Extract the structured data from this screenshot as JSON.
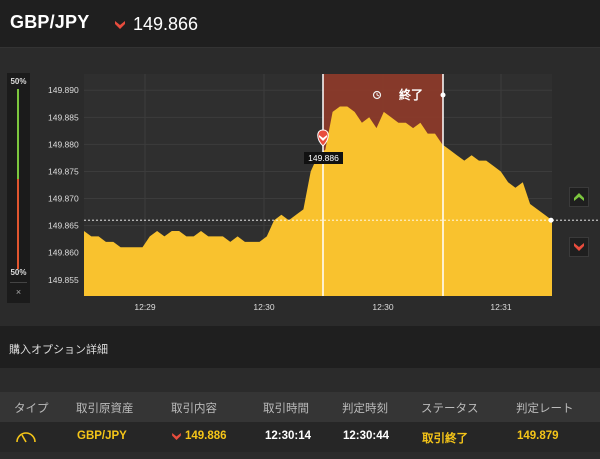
{
  "header": {
    "pair": "GBP/JPY",
    "rate": "149.866",
    "direction_icon": "down-arrow-icon",
    "down_color": "#e84c3d"
  },
  "gauge": {
    "top_label": "50%",
    "bottom_label": "50%",
    "close_label": "×",
    "call_fraction": 0.5,
    "put_fraction": 0.5,
    "call_color": "#7cc63e",
    "put_color": "#e0552f"
  },
  "chart_data": {
    "type": "area",
    "y_ticks": [
      "149.890",
      "149.885",
      "149.880",
      "149.875",
      "149.870",
      "149.865",
      "149.860",
      "149.855"
    ],
    "x_ticks": [
      "12:29",
      "12:30",
      "12:30",
      "12:31"
    ],
    "ylim": [
      149.852,
      149.893
    ],
    "current_rate": 149.866,
    "entry_rate_label": "149.886",
    "expiry_label": "終了",
    "fill_color": "#f9c22e",
    "series": [
      {
        "values": [
          149.864,
          149.863,
          149.863,
          149.862,
          149.862,
          149.861,
          149.861,
          149.861,
          149.861,
          149.863,
          149.864,
          149.863,
          149.864,
          149.864,
          149.863,
          149.863,
          149.864,
          149.863,
          149.863,
          149.863,
          149.862,
          149.863,
          149.862,
          149.862,
          149.862,
          149.863,
          149.866,
          149.867,
          149.866,
          149.867,
          149.868,
          149.875,
          149.878,
          149.879,
          149.886,
          149.887,
          149.887,
          149.886,
          149.884,
          149.885,
          149.883,
          149.886,
          149.885,
          149.884,
          149.884,
          149.883,
          149.884,
          149.882,
          149.882,
          149.88,
          149.879,
          149.878,
          149.877,
          149.878,
          149.877,
          149.877,
          149.876,
          149.875,
          149.873,
          149.872,
          149.873,
          149.869,
          149.868,
          149.867,
          149.866
        ]
      }
    ]
  },
  "side_buttons": {
    "up_icon": "chevron-up-icon",
    "down_icon": "chevron-down-icon",
    "up_color": "#7cc63e",
    "down_color": "#e84c3d"
  },
  "section": {
    "title": "購入オプション詳細"
  },
  "table": {
    "headers": [
      "タイプ",
      "取引原資産",
      "取引内容",
      "取引時間",
      "判定時刻",
      "ステータス",
      "判定レート"
    ],
    "row": {
      "type_icon": "gauge-icon",
      "asset": "GBP/JPY",
      "content_icon": "down-arrow-icon",
      "content": "149.886",
      "trade_time": "12:30:14",
      "judge_time": "12:30:44",
      "status": "取引終了",
      "judge_rate": "149.879"
    }
  }
}
